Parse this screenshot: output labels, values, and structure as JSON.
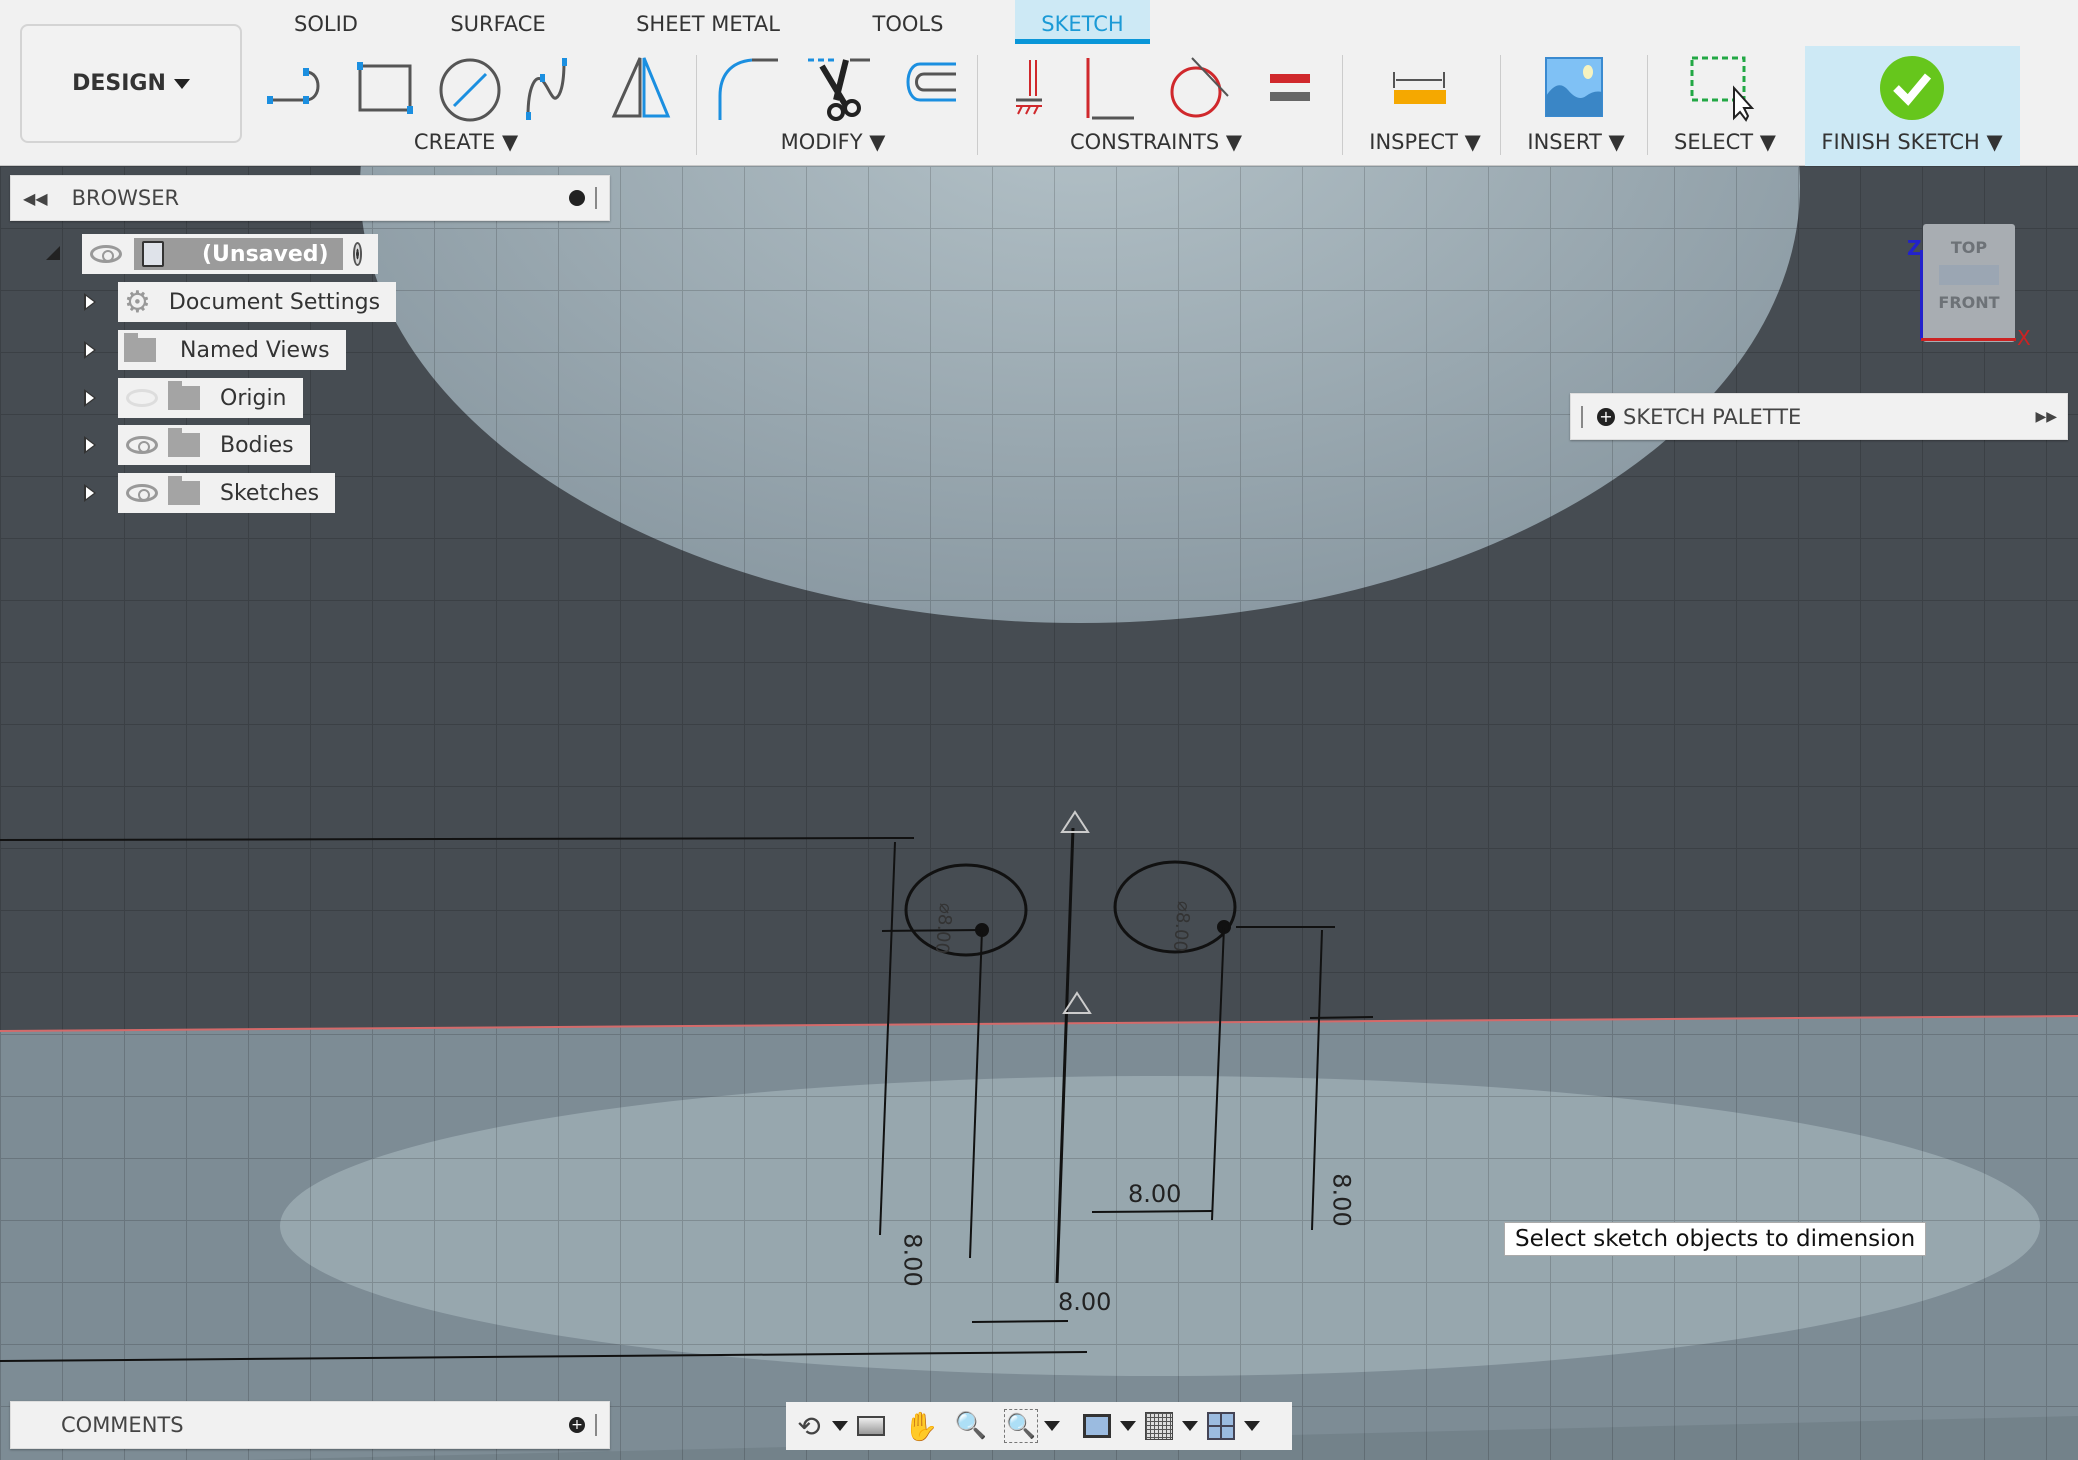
{
  "toolbar": {
    "workspace": "DESIGN",
    "tabs": [
      "SOLID",
      "SURFACE",
      "SHEET METAL",
      "TOOLS",
      "SKETCH"
    ],
    "active_tab": "SKETCH",
    "groups": {
      "create": "CREATE",
      "modify": "MODIFY",
      "constraints": "CONSTRAINTS",
      "inspect": "INSPECT",
      "insert": "INSERT",
      "select": "SELECT",
      "finish": "FINISH SKETCH"
    }
  },
  "browser": {
    "title": "BROWSER",
    "root": "(Unsaved)",
    "items": [
      {
        "label": "Document Settings",
        "icon": "gear-icon"
      },
      {
        "label": "Named Views",
        "icon": "folder-icon"
      },
      {
        "label": "Origin",
        "icon": "folder-icon",
        "visible": false
      },
      {
        "label": "Bodies",
        "icon": "folder-icon",
        "visible": true
      },
      {
        "label": "Sketches",
        "icon": "folder-icon",
        "visible": true
      }
    ]
  },
  "sketch_palette": {
    "title": "SKETCH PALETTE"
  },
  "viewcube": {
    "top": "TOP",
    "front": "FRONT",
    "z": "Z",
    "x": "X"
  },
  "sketch": {
    "diameter_1": "⌀8.00",
    "diameter_2": "⌀8.00",
    "dim_left_vertical": "8.00",
    "dim_bottom_horizontal": "8.00",
    "dim_middle_horizontal": "8.00",
    "dim_right_vertical": "8.00"
  },
  "tooltip": "Select sketch objects to dimension",
  "comments": {
    "title": "COMMENTS"
  },
  "colors": {
    "accent": "#0a96d8",
    "finish": "#66c61c",
    "constraint": "#d0282c"
  }
}
